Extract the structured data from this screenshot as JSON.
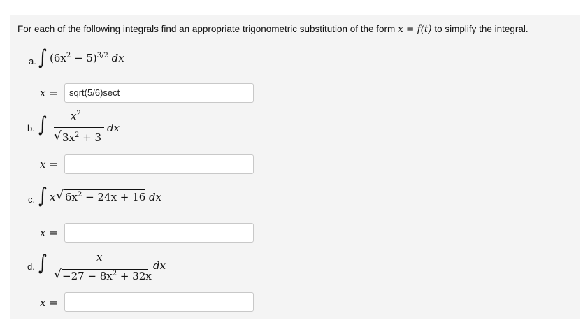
{
  "instruction": {
    "text": "For each of the following integrals find an appropriate trigonometric substitution of the form",
    "form_lhs": "x",
    "form_eq": " = ",
    "form_rhs": "f(t)",
    "suffix": "to simplify the integral."
  },
  "integral_symbol": "∫",
  "answer_label": {
    "var": "x",
    "eq": " ="
  },
  "problems": [
    {
      "letter": "a.",
      "parts": {
        "open": "(6x",
        "sq": "2",
        "mid": " − 5)",
        "pow": "3/2",
        "dx": " dx"
      },
      "answer_value": "sqrt(5/6)sect"
    },
    {
      "letter": "b.",
      "parts": {
        "num_var": "x",
        "num_sq": "2",
        "den_a": "3x",
        "den_sq": "2",
        "den_b": " + 3",
        "dx": "dx"
      },
      "answer_value": ""
    },
    {
      "letter": "c.",
      "parts": {
        "lead": "x",
        "rad_a": "6x",
        "rad_sq": "2",
        "rad_b": " − 24x + 16",
        "dx": " dx"
      },
      "answer_value": ""
    },
    {
      "letter": "d.",
      "parts": {
        "num": "x",
        "den_a": "−27 − 8x",
        "den_sq": "2",
        "den_b": " + 32x",
        "dx": "dx"
      },
      "answer_value": ""
    }
  ]
}
